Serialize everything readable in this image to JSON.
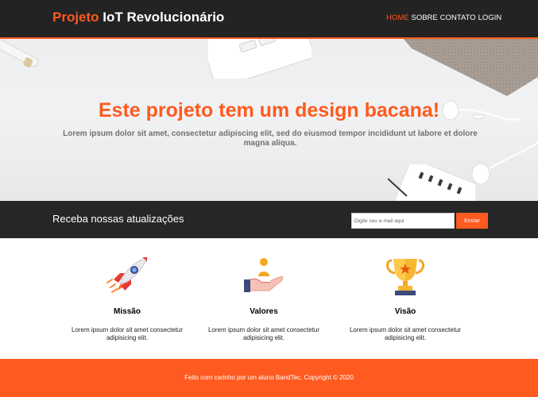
{
  "header": {
    "brand_accent": "Projeto",
    "brand_rest": " IoT Revolucionário",
    "nav": [
      "HOME",
      "SOBRE",
      "CONTATO",
      "LOGIN"
    ]
  },
  "hero": {
    "title": "Este projeto tem um design bacana!",
    "text": "Lorem ipsum dolor sit amet, consectetur adipiscing elit, sed do eiusmod tempor incididunt ut labore et dolore magna aliqua."
  },
  "newsletter": {
    "title": "Receba nossas atualizações",
    "email_placeholder": "Digite seu e-mail aqui",
    "send_label": "Enviar"
  },
  "features": [
    {
      "icon": "rocket-icon",
      "title": "Missão",
      "text": "Lorem ipsum dolor sit amet consectetur adipisicing elit."
    },
    {
      "icon": "hand-person-icon",
      "title": "Valores",
      "text": "Lorem ipsum dolor sit amet consectetur adipisicing elit."
    },
    {
      "icon": "trophy-icon",
      "title": "Visão",
      "text": "Lorem ipsum dolor sit amet consectetur adipisicing elit."
    }
  ],
  "footer": {
    "text": "Feito com carinho por um aluno BandTec. Copyright © 2020"
  },
  "colors": {
    "accent": "#ff5a1f",
    "header_bg": "#232323",
    "newsletter_bg": "#262626"
  }
}
